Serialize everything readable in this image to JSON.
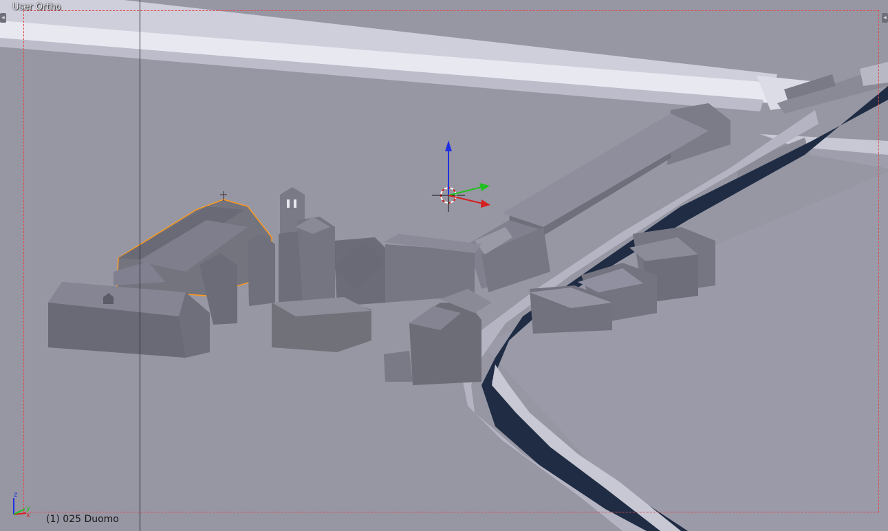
{
  "viewport": {
    "view_label": "User Ortho",
    "object_label": "(1) 025 Duomo",
    "background": "#9797a4"
  },
  "axes": {
    "z_label": "z",
    "y_label": "y",
    "x_label": "x",
    "colors": {
      "x": "#d42020",
      "y": "#20c020",
      "z": "#2030e0"
    }
  },
  "colors": {
    "camera_frame": "#e04a4a",
    "selection_outline": "#ff9a1a",
    "water": "#1f2c44",
    "building": "#6d6d77",
    "roof": "#5b5b68",
    "terrain": "#9797a4"
  },
  "icons": {
    "cursor": "3d-cursor-icon",
    "corner": "corner-widget-icon"
  }
}
